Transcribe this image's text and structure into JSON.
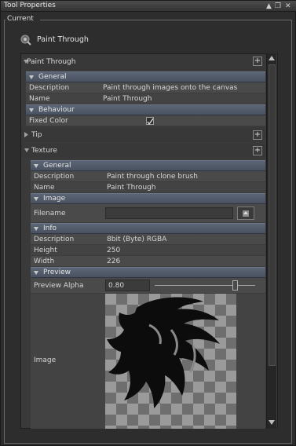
{
  "window": {
    "title": "Tool Properties"
  },
  "group_label": "Current",
  "tool": {
    "name": "Paint Through"
  },
  "panel": {
    "title": "Paint Through",
    "general": {
      "header": "General",
      "rows": [
        {
          "label": "Description",
          "value": "Paint through images onto the canvas"
        },
        {
          "label": "Name",
          "value": "Paint Through"
        }
      ]
    },
    "behaviour": {
      "header": "Behaviour",
      "fixed_color_label": "Fixed Color",
      "fixed_color_checked": true
    },
    "tip": {
      "header": "Tip"
    },
    "texture": {
      "header": "Texture",
      "general": {
        "header": "General",
        "rows": [
          {
            "label": "Description",
            "value": "Paint through clone brush"
          },
          {
            "label": "Name",
            "value": "Paint Through"
          }
        ]
      },
      "image": {
        "header": "Image",
        "filename_label": "Filename",
        "filename_value": ""
      },
      "info": {
        "header": "Info",
        "rows": [
          {
            "label": "Description",
            "value": "8bit  (Byte) RGBA"
          },
          {
            "label": "Height",
            "value": "250"
          },
          {
            "label": "Width",
            "value": "226"
          }
        ]
      },
      "preview": {
        "header": "Preview",
        "alpha_label": "Preview Alpha",
        "alpha_value": "0.80",
        "alpha_fraction": 0.8,
        "image_label": "Image"
      }
    }
  },
  "colors": {
    "header": "#525c6b",
    "row": "#4a4a4a",
    "accent_text": "#d6d6d6"
  }
}
